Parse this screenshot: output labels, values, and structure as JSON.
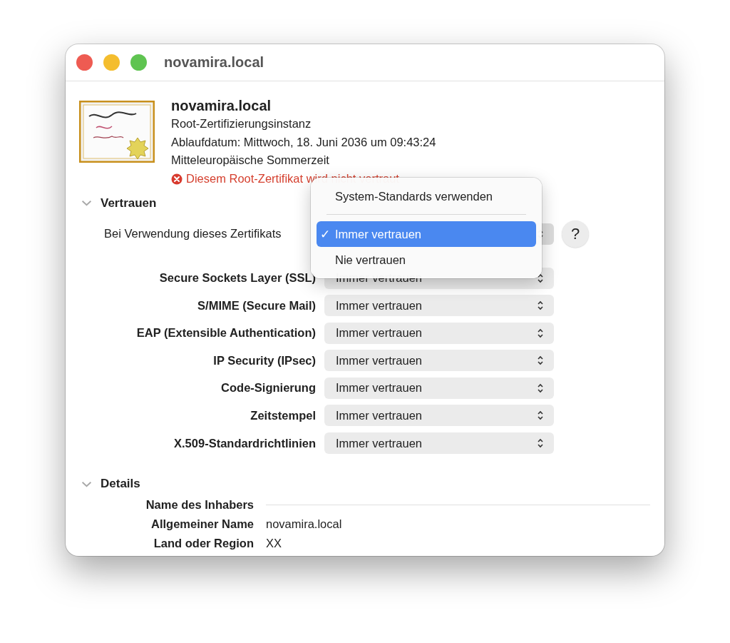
{
  "window": {
    "title": "novamira.local"
  },
  "certificate": {
    "name": "novamira.local",
    "type": "Root-Zertifizierungsinstanz",
    "expiry": "Ablaufdatum: Mittwoch, 18. Juni 2036 um 09:43:24",
    "timezone": "Mitteleuropäische Sommerzeit",
    "status": "Diesem Root-Zertifikat wird nicht vertraut",
    "trusted": false
  },
  "trust": {
    "title": "Vertrauen",
    "expanded": true,
    "when_using_label": "Bei Verwendung dieses Zertifikats",
    "help": "?",
    "policies": [
      {
        "label": "Secure Sockets Layer (SSL)",
        "value": "Immer vertrauen"
      },
      {
        "label": "S/MIME (Secure Mail)",
        "value": "Immer vertrauen"
      },
      {
        "label": "EAP (Extensible Authentication)",
        "value": "Immer vertrauen"
      },
      {
        "label": "IP Security (IPsec)",
        "value": "Immer vertrauen"
      },
      {
        "label": "Code-Signierung",
        "value": "Immer vertrauen"
      },
      {
        "label": "Zeitstempel",
        "value": "Immer vertrauen"
      },
      {
        "label": "X.509-Standardrichtlinien",
        "value": "Immer vertrauen"
      }
    ]
  },
  "menu": {
    "check": "✓",
    "items": [
      {
        "kind": "option",
        "label": "System-Standards verwenden",
        "selected": false
      },
      {
        "kind": "separator"
      },
      {
        "kind": "option",
        "label": "Immer vertrauen",
        "selected": true
      },
      {
        "kind": "option",
        "label": "Nie vertrauen",
        "selected": false
      }
    ]
  },
  "details": {
    "title": "Details",
    "expanded": true,
    "rows": [
      {
        "kind": "header",
        "label": "Name des Inhabers"
      },
      {
        "kind": "field",
        "label": "Allgemeiner Name",
        "value": "novamira.local"
      },
      {
        "kind": "field",
        "label": "Land oder Region",
        "value": "XX"
      }
    ]
  }
}
